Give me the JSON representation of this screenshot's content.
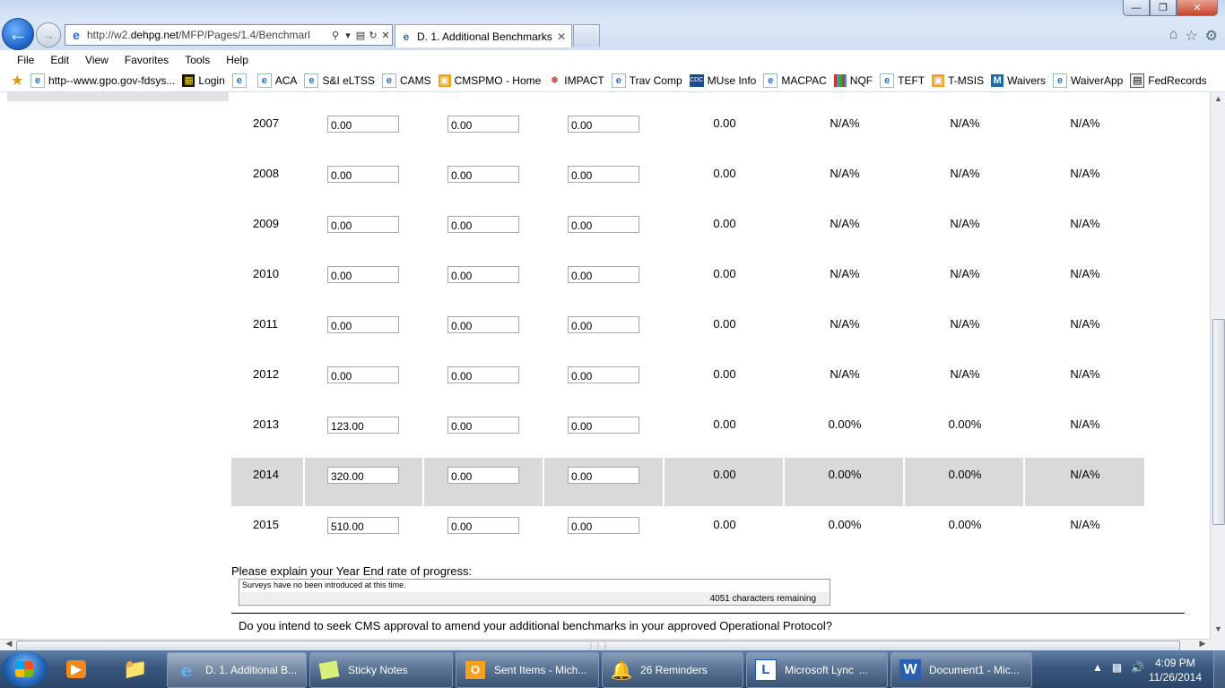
{
  "browser": {
    "address_url_pre": "http://w2.",
    "address_url_host": "dehpg.net",
    "address_url_post": "/MFP/Pages/1.4/Benchmarl",
    "tab_title": "D. 1. Additional Benchmarks",
    "menu": [
      "File",
      "Edit",
      "View",
      "Favorites",
      "Tools",
      "Help"
    ],
    "favorites": [
      {
        "label": "http--www.gpo.gov-fdsys...",
        "icon": "ie-page-icon"
      },
      {
        "label": "Login",
        "icon": "login-icon"
      },
      {
        "label": "",
        "icon": "ie-page-icon"
      },
      {
        "label": "ACA",
        "icon": "ie-page-icon"
      },
      {
        "label": "S&I eLTSS",
        "icon": "ie-page-icon"
      },
      {
        "label": "CAMS",
        "icon": "ie-page-icon"
      },
      {
        "label": "CMSPMO - Home",
        "icon": "sharepoint-icon"
      },
      {
        "label": "IMPACT",
        "icon": "eagle-icon"
      },
      {
        "label": "Trav Comp",
        "icon": "ie-page-icon"
      },
      {
        "label": "MUse Info",
        "icon": "cdc-icon"
      },
      {
        "label": "MACPAC",
        "icon": "ie-page-icon"
      },
      {
        "label": "NQF",
        "icon": "grid-icon"
      },
      {
        "label": "TEFT",
        "icon": "ie-page-icon"
      },
      {
        "label": "T-MSIS",
        "icon": "sharepoint-icon"
      },
      {
        "label": "Waivers",
        "icon": "m-icon"
      },
      {
        "label": "WaiverApp",
        "icon": "ie-page-icon"
      },
      {
        "label": "FedRecords",
        "icon": "records-icon"
      }
    ]
  },
  "table": {
    "rows": [
      {
        "year": "2007",
        "in1": "0.00",
        "in2": "0.00",
        "in3": "0.00",
        "total": "0.00",
        "p1": "N/A%",
        "p2": "N/A%",
        "p3": "N/A%",
        "highlight": false
      },
      {
        "year": "2008",
        "in1": "0.00",
        "in2": "0.00",
        "in3": "0.00",
        "total": "0.00",
        "p1": "N/A%",
        "p2": "N/A%",
        "p3": "N/A%",
        "highlight": false
      },
      {
        "year": "2009",
        "in1": "0.00",
        "in2": "0.00",
        "in3": "0.00",
        "total": "0.00",
        "p1": "N/A%",
        "p2": "N/A%",
        "p3": "N/A%",
        "highlight": false
      },
      {
        "year": "2010",
        "in1": "0.00",
        "in2": "0.00",
        "in3": "0.00",
        "total": "0.00",
        "p1": "N/A%",
        "p2": "N/A%",
        "p3": "N/A%",
        "highlight": false
      },
      {
        "year": "2011",
        "in1": "0.00",
        "in2": "0.00",
        "in3": "0.00",
        "total": "0.00",
        "p1": "N/A%",
        "p2": "N/A%",
        "p3": "N/A%",
        "highlight": false
      },
      {
        "year": "2012",
        "in1": "0.00",
        "in2": "0.00",
        "in3": "0.00",
        "total": "0.00",
        "p1": "N/A%",
        "p2": "N/A%",
        "p3": "N/A%",
        "highlight": false
      },
      {
        "year": "2013",
        "in1": "123.00",
        "in2": "0.00",
        "in3": "0.00",
        "total": "0.00",
        "p1": "0.00%",
        "p2": "0.00%",
        "p3": "N/A%",
        "highlight": false
      },
      {
        "year": "2014",
        "in1": "320.00",
        "in2": "0.00",
        "in3": "0.00",
        "total": "0.00",
        "p1": "0.00%",
        "p2": "0.00%",
        "p3": "N/A%",
        "highlight": true
      },
      {
        "year": "2015",
        "in1": "510.00",
        "in2": "0.00",
        "in3": "0.00",
        "total": "0.00",
        "p1": "0.00%",
        "p2": "0.00%",
        "p3": "N/A%",
        "highlight": false
      }
    ]
  },
  "explain": {
    "label": "Please explain your Year End rate of progress:",
    "text": "Surveys have no been introduced at this time.",
    "remaining_count": "4051",
    "remaining_label": "characters remaining"
  },
  "question": "Do you intend to seek CMS approval to amend your additional benchmarks in your approved Operational Protocol?",
  "taskbar": {
    "tasks": [
      {
        "label": "D. 1. Additional B...",
        "icon": "ie-icon",
        "active": true
      },
      {
        "label": "Sticky Notes",
        "icon": "sticky-notes-icon",
        "active": false
      },
      {
        "label": "Sent Items - Mich...",
        "icon": "outlook-icon",
        "active": false
      },
      {
        "label": "26 Reminders",
        "icon": "bell-icon",
        "active": false
      },
      {
        "label": "Microsoft Lync",
        "icon": "lync-icon",
        "active": false
      },
      {
        "label": "Document1 - Mic...",
        "icon": "word-icon",
        "active": false
      }
    ],
    "time": "4:09 PM",
    "date": "11/26/2014"
  }
}
